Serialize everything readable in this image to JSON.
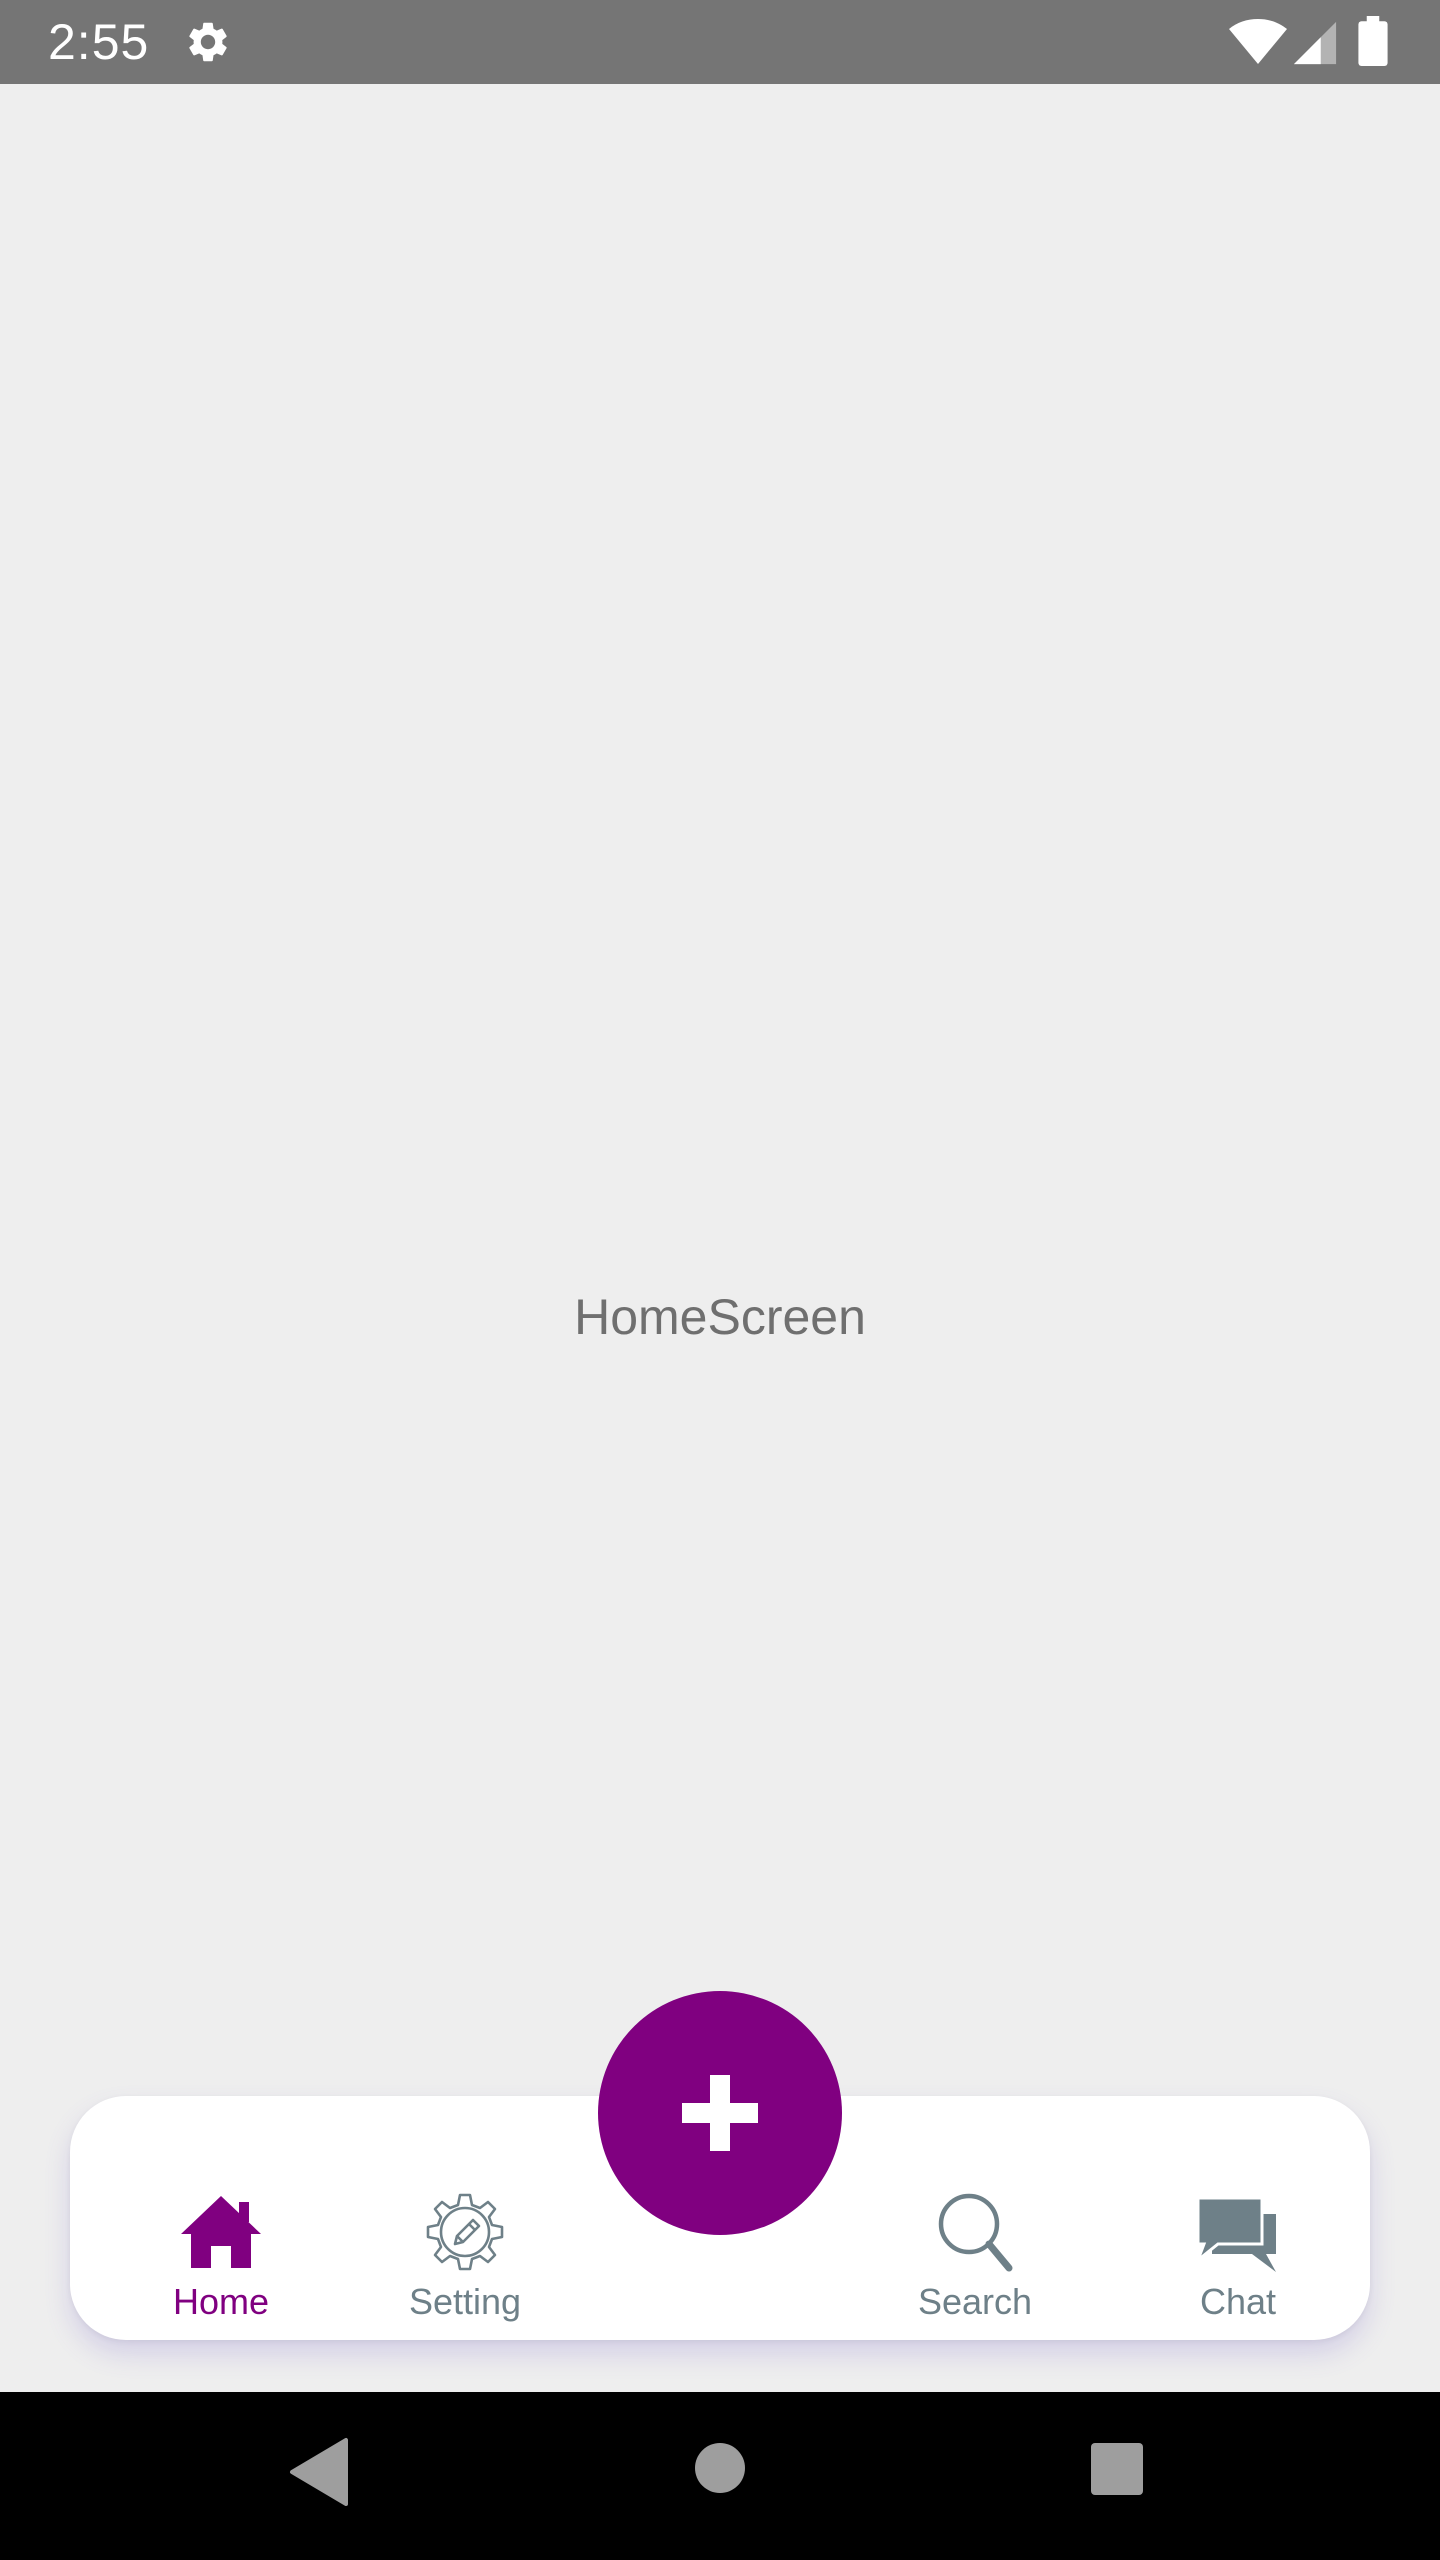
{
  "status_bar": {
    "time": "2:55",
    "icons": [
      "gear-icon",
      "wifi-icon",
      "cellular-signal-icon",
      "battery-icon"
    ]
  },
  "main": {
    "screen_label": "HomeScreen"
  },
  "bottom_nav": {
    "items": [
      {
        "label": "Home",
        "icon": "home-icon",
        "selected": true
      },
      {
        "label": "Setting",
        "icon": "settings-gear-icon",
        "selected": false
      },
      {
        "label": "Search",
        "icon": "search-icon",
        "selected": false
      },
      {
        "label": "Chat",
        "icon": "chat-icon",
        "selected": false
      }
    ],
    "fab_icon": "plus-icon"
  },
  "system_nav": {
    "icons": [
      "back-icon",
      "home-circle-icon",
      "recents-icon"
    ]
  },
  "colors": {
    "accent": "#800080",
    "inactive": "#6e8088",
    "background": "#eeeeee",
    "status_bar": "#757575",
    "nav_bar": "#000000"
  }
}
